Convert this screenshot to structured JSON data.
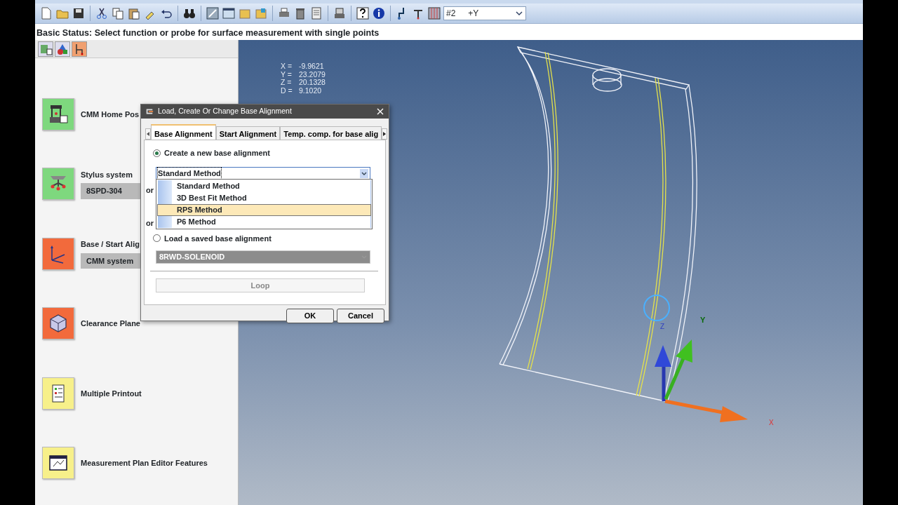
{
  "toolbar": {
    "combo": {
      "number": "#2",
      "direction": "+Y"
    }
  },
  "status": {
    "label": "Basic Status:",
    "text": "Select function or probe for surface measurement with single points"
  },
  "sidebar": {
    "items": [
      {
        "kind": "plain",
        "label": "CMM Home Pos",
        "color": "#7ed87e"
      },
      {
        "kind": "field",
        "label": "Stylus system",
        "value": "8SPD-304",
        "color": "#7ed87e"
      },
      {
        "kind": "field",
        "label": "Base / Start Alig",
        "value": "CMM system",
        "color": "#f26a3c"
      },
      {
        "kind": "plain",
        "label": "Clearance Plane",
        "color": "#f26a3c"
      },
      {
        "kind": "plain",
        "label": "Multiple Printout",
        "color": "#f7f08a"
      },
      {
        "kind": "plain",
        "label": "Measurement Plan Editor Features",
        "color": "#f7f08a"
      }
    ]
  },
  "viewport": {
    "readout": [
      {
        "label": "X =",
        "value": "-9.9621"
      },
      {
        "label": "Y =",
        "value": "23.2079"
      },
      {
        "label": "Z =",
        "value": "20.1328"
      },
      {
        "label": "D =",
        "value": "9.1020"
      }
    ],
    "axes": {
      "x": "X",
      "y": "Y",
      "z": "Z"
    }
  },
  "dialog": {
    "title": "Load, Create Or Change Base Alignment",
    "tabs": [
      {
        "label": "Base Alignment",
        "selected": true
      },
      {
        "label": "Start Alignment",
        "selected": false
      },
      {
        "label": "Temp. comp. for base alig",
        "selected": false
      }
    ],
    "create_option": {
      "label": "Create a new base alignment",
      "selected": true
    },
    "method_combo": {
      "value": "Standard Method",
      "expanded": true,
      "items": [
        {
          "label": "Standard Method",
          "highlighted": false
        },
        {
          "label": "3D Best Fit Method",
          "highlighted": false
        },
        {
          "label": "RPS Method",
          "highlighted": true
        },
        {
          "label": "P6 Method",
          "highlighted": false
        }
      ]
    },
    "or_labels": [
      "or",
      "or"
    ],
    "load_option": {
      "label": "Load a saved base alignment",
      "selected": false
    },
    "saved_combo": {
      "value": "8RWD-SOLENOID",
      "disabled": true
    },
    "loop_button": {
      "label": "Loop",
      "disabled": true
    },
    "buttons": [
      "OK",
      "Cancel"
    ]
  }
}
